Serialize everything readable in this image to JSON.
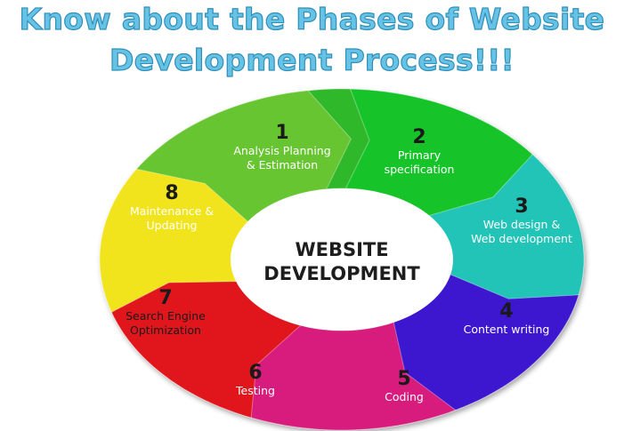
{
  "title": {
    "line1": "Know about the Phases of Website",
    "line2": "Development Process!!!"
  },
  "center": {
    "line1": "WEBSITE",
    "line2": "DEVELOPMENT"
  },
  "phases": [
    {
      "number": "1",
      "lines": [
        "Analysis Planning",
        "& Estimation"
      ],
      "color": "#2fb82c"
    },
    {
      "number": "2",
      "lines": [
        "Primary",
        "specification"
      ],
      "color": "#16c42c"
    },
    {
      "number": "3",
      "lines": [
        "Web design &",
        "Web development"
      ],
      "color": "#23c4b7"
    },
    {
      "number": "4",
      "lines": [
        "Content writing"
      ],
      "color": "#3d13cf"
    },
    {
      "number": "5",
      "lines": [
        "Coding"
      ],
      "color": "#d81a7e"
    },
    {
      "number": "6",
      "lines": [
        "Testing"
      ],
      "color": "#e0161c"
    },
    {
      "number": "7",
      "lines": [
        "Search Engine",
        "Optimization"
      ],
      "color": "#f1e41a"
    },
    {
      "number": "8",
      "lines": [
        "Maintenance &",
        "Updating"
      ],
      "color": "#68c531"
    }
  ]
}
